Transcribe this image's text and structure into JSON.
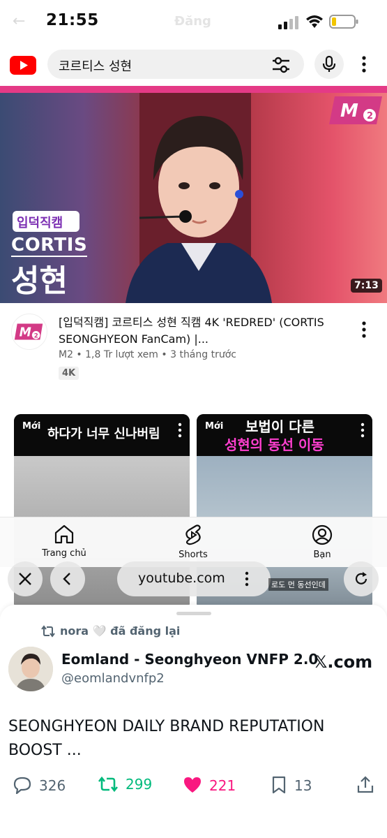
{
  "status_bar": {
    "time": "21:55",
    "ghost_text": "Đăng"
  },
  "search": {
    "query": "코르티스 성현"
  },
  "video": {
    "thumbnail": {
      "badge_label": "입덕직캠",
      "group": "CORTIS",
      "member": "성현",
      "logo_text": "M2",
      "duration": "7:13"
    },
    "title": "[입덕직캠] 코르티스 성현 직캠 4K 'REDRED' (CORTIS SEONGHYEON FanCam) |...",
    "meta": "M2 • 1,8 Tr lượt xem • 3 tháng trước",
    "tag": "4K",
    "channel_logo": "M2"
  },
  "shorts": [
    {
      "badge": "Mới",
      "caption": "하다가 너무 신나버림"
    },
    {
      "badge": "Mới",
      "caption_line1": "보법이 다른",
      "caption_line2": "성현의 동선 이동",
      "bottom_caption": "로도 먼 동선인데"
    }
  ],
  "yt_nav": {
    "home": "Trang chủ",
    "shorts": "Shorts",
    "you": "Bạn"
  },
  "browser": {
    "url": "youtube.com"
  },
  "tweet": {
    "repost_text": "nora 🤍 đã đăng lại",
    "author_name": "Eomland - Seonghyeon VNFP 2.0",
    "author_handle": "@eomlandvnfp2",
    "site": "𝕏.com",
    "text": "SEONGHYEON DAILY BRAND REPUTATION BOOST ...",
    "replies": "326",
    "reposts": "299",
    "likes": "221",
    "bookmarks": "13"
  },
  "colors": {
    "youtube_red": "#ff0000",
    "repost_green": "#00ba7c",
    "like_pink": "#f91880",
    "muted": "#536471"
  }
}
